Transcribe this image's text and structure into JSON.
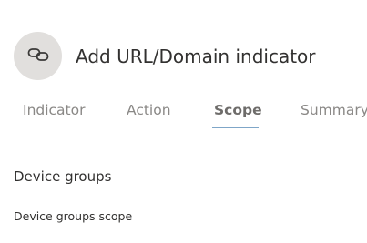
{
  "header": {
    "icon": "link-icon",
    "title": "Add URL/Domain indicator"
  },
  "tabs": [
    {
      "label": "Indicator",
      "selected": false
    },
    {
      "label": "Action",
      "selected": false
    },
    {
      "label": "Scope",
      "selected": true
    },
    {
      "label": "Summary",
      "selected": false
    }
  ],
  "colors": {
    "avatar_bg": "#e1dfdd",
    "tab_underline": "#7fa6c8",
    "text": "#323130",
    "tab_inactive": "#8a8886"
  },
  "scope": {
    "section_heading": "Device groups",
    "field_label": "Device groups scope"
  }
}
